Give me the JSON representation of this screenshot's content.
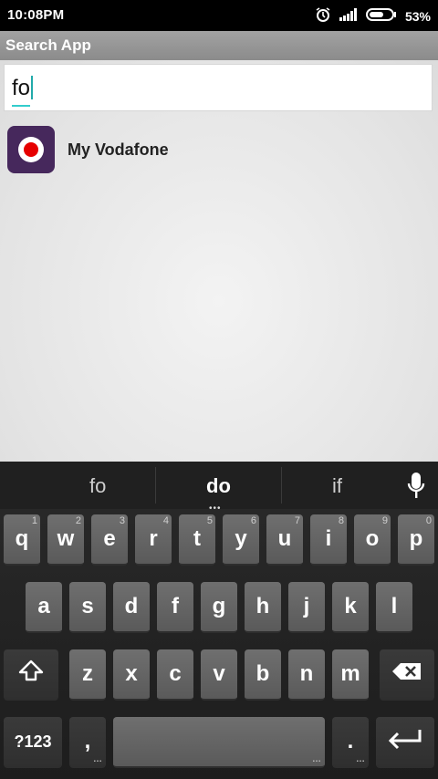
{
  "status_bar": {
    "time": "10:08PM",
    "battery_percent": "53%"
  },
  "app": {
    "title": "Search App"
  },
  "search": {
    "value": "fo"
  },
  "results": [
    {
      "name": "My Vodafone"
    }
  ],
  "keyboard": {
    "suggestions": [
      "fo",
      "do",
      "if"
    ],
    "row1": [
      {
        "label": "q",
        "num": "1"
      },
      {
        "label": "w",
        "num": "2"
      },
      {
        "label": "e",
        "num": "3"
      },
      {
        "label": "r",
        "num": "4"
      },
      {
        "label": "t",
        "num": "5"
      },
      {
        "label": "y",
        "num": "6"
      },
      {
        "label": "u",
        "num": "7"
      },
      {
        "label": "i",
        "num": "8"
      },
      {
        "label": "o",
        "num": "9"
      },
      {
        "label": "p",
        "num": "0"
      }
    ],
    "row2": [
      "a",
      "s",
      "d",
      "f",
      "g",
      "h",
      "j",
      "k",
      "l"
    ],
    "row3": [
      "z",
      "x",
      "c",
      "v",
      "b",
      "n",
      "m"
    ],
    "symbols_label": "?123",
    "comma_label": ",",
    "period_label": "."
  }
}
